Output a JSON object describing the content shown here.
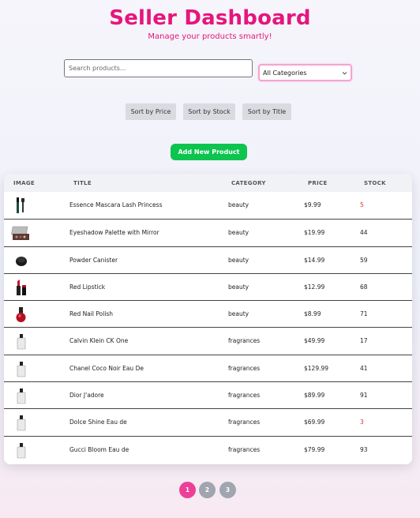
{
  "header": {
    "title": "Seller Dashboard",
    "subtitle": "Manage your products smartly!"
  },
  "search": {
    "placeholder": "Search products...",
    "value": ""
  },
  "category_select": {
    "selected": "All Categories"
  },
  "sort_buttons": [
    "Sort by Price",
    "Sort by Stock",
    "Sort by Title"
  ],
  "add_button": "Add New Product",
  "table": {
    "headers": [
      "IMAGE",
      "TITLE",
      "CATEGORY",
      "PRICE",
      "STOCK"
    ],
    "rows": [
      {
        "title": "Essence Mascara Lash Princess",
        "category": "beauty",
        "price": "$9.99",
        "stock": "5",
        "low": true,
        "icon": "mascara-icon"
      },
      {
        "title": "Eyeshadow Palette with Mirror",
        "category": "beauty",
        "price": "$19.99",
        "stock": "44",
        "low": false,
        "icon": "eyeshadow-palette-icon"
      },
      {
        "title": "Powder Canister",
        "category": "beauty",
        "price": "$14.99",
        "stock": "59",
        "low": false,
        "icon": "powder-canister-icon"
      },
      {
        "title": "Red Lipstick",
        "category": "beauty",
        "price": "$12.99",
        "stock": "68",
        "low": false,
        "icon": "lipstick-icon"
      },
      {
        "title": "Red Nail Polish",
        "category": "beauty",
        "price": "$8.99",
        "stock": "71",
        "low": false,
        "icon": "nail-polish-icon"
      },
      {
        "title": "Calvin Klein CK One",
        "category": "fragrances",
        "price": "$49.99",
        "stock": "17",
        "low": false,
        "icon": "perfume-bottle-icon"
      },
      {
        "title": "Chanel Coco Noir Eau De",
        "category": "fragrances",
        "price": "$129.99",
        "stock": "41",
        "low": false,
        "icon": "perfume-bottle-icon"
      },
      {
        "title": "Dior J'adore",
        "category": "fragrances",
        "price": "$89.99",
        "stock": "91",
        "low": false,
        "icon": "perfume-bottle-icon"
      },
      {
        "title": "Dolce Shine Eau de",
        "category": "fragrances",
        "price": "$69.99",
        "stock": "3",
        "low": true,
        "icon": "perfume-bottle-icon"
      },
      {
        "title": "Gucci Bloom Eau de",
        "category": "fragrances",
        "price": "$79.99",
        "stock": "93",
        "low": false,
        "icon": "perfume-bottle-icon"
      }
    ]
  },
  "pagination": {
    "pages": [
      "1",
      "2",
      "3"
    ],
    "current": "1"
  },
  "colors": {
    "accent": "#e6157d",
    "add_button": "#0dc44f",
    "low_stock": "#e33030",
    "pager_active": "#ec3f97",
    "pager_inactive": "#a0a5b0"
  }
}
